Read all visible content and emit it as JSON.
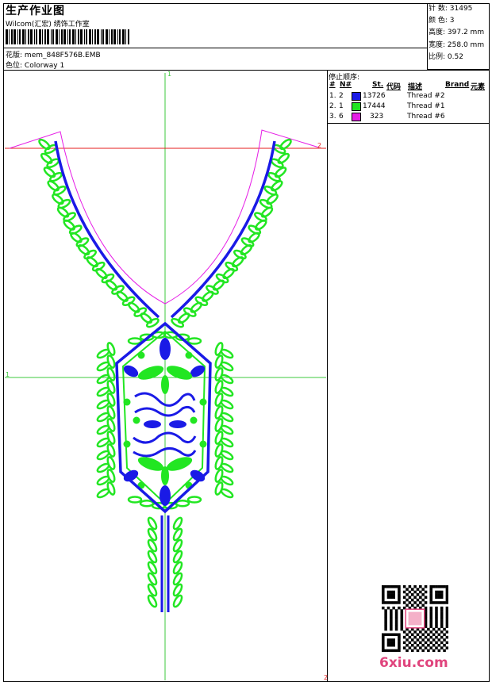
{
  "header": {
    "title": "生产作业图",
    "company": "Wilcom(汇宏) 绣饰工作室",
    "design_label": "花版:",
    "design_file": "mem_848F576B.EMB",
    "colorway_label": "色位:",
    "colorway": "Colorway 1"
  },
  "stats": [
    {
      "label": "针 数:",
      "value": "31495"
    },
    {
      "label": "颜 色:",
      "value": "3"
    },
    {
      "label": "高度:",
      "value": "397.2 mm"
    },
    {
      "label": "宽度:",
      "value": "258.0 mm"
    },
    {
      "label": "比例:",
      "value": "0.52"
    }
  ],
  "threads": {
    "title": "停止顺序:",
    "columns": {
      "num": "#",
      "n": "N#",
      "st": "St.",
      "code": "代码",
      "desc": "描述",
      "brand": "Brand",
      "elem": "元素"
    },
    "rows": [
      {
        "idx": "1.",
        "n": "2",
        "color": "#1a1ae6",
        "stitches": "13726",
        "desc": "Thread #2"
      },
      {
        "idx": "2.",
        "n": "1",
        "color": "#22e622",
        "stitches": "17444",
        "desc": "Thread #1"
      },
      {
        "idx": "3.",
        "n": "6",
        "color": "#e61ee6",
        "stitches": "323",
        "desc": "Thread #6"
      }
    ]
  },
  "markers": {
    "top": "1",
    "left": "1",
    "right": "2",
    "bottom": "2"
  },
  "colors": {
    "blue": "#1a1ae6",
    "green": "#22e622",
    "magenta": "#e61ee6",
    "guide_green": "#3cc83c",
    "guide_red": "#e61e1e"
  },
  "watermark": "6xiu.com"
}
